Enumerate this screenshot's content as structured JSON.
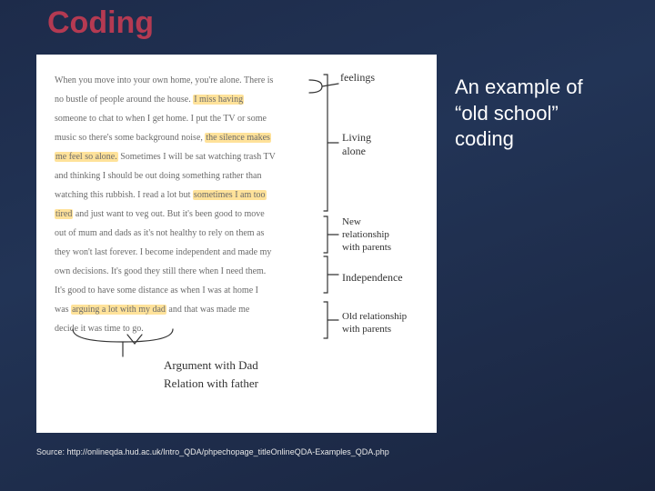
{
  "title": "Coding",
  "caption": "An example of “old school” coding",
  "source": "Source: http://onlineqda.hud.ac.uk/Intro_QDA/phpechopage_titleOnlineQDA-Examples_QDA.php",
  "interview": {
    "l1a": "When you move into your own home, you're alone. There is",
    "l2a": "no bustle of people around the house. ",
    "l2h": "I miss having",
    "l3a": "someone to chat to when I get home. I put the TV or some",
    "l4a": "music so there's some background noise, ",
    "l4h": "the silence makes",
    "l5h": "me feel so alone.",
    "l5b": " Sometimes I will be sat watching trash TV",
    "l6a": "and thinking I should be out doing something rather than",
    "l7a": "watching this rubbish. I read a lot but ",
    "l7h": "sometimes I am too",
    "l8h": "tired",
    "l8b": " and just want to veg out. But it's been good to move",
    "l9a": "out of mum and dads as it's not healthy to rely on them as",
    "l10a": "they won't last forever. I become independent and made my",
    "l11a": "own decisions. It's good they still there when I need them.",
    "l12a": "It's good to have some distance as when I was at home I",
    "l13a": "was ",
    "l13h": "arguing a lot with my dad",
    "l13b": " and that was made me",
    "l14a": "decide it was time to go."
  },
  "codes": {
    "feelings": "feelings",
    "living_alone": "Living\nalone",
    "new_relationship": "New\nrelationship\nwith parents",
    "independence": "Independence",
    "old_relationship": "Old relationship\nwith parents",
    "argument": "Argument with Dad",
    "relation_father": "Relation with father"
  }
}
